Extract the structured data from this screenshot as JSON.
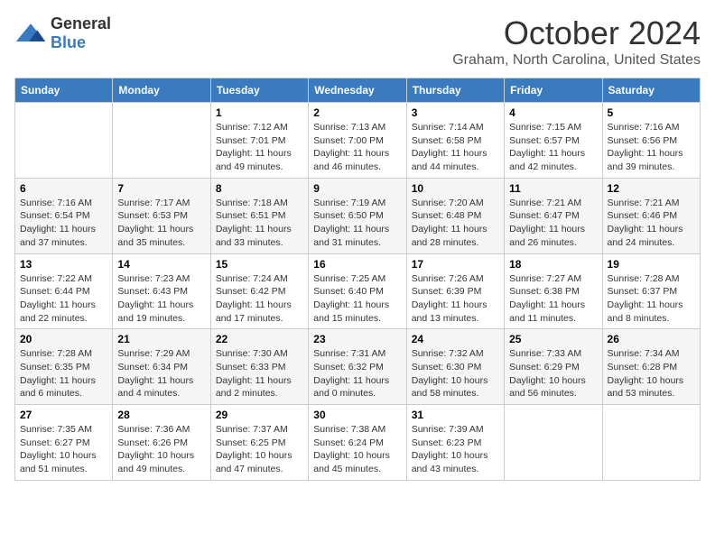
{
  "logo": {
    "general": "General",
    "blue": "Blue"
  },
  "header": {
    "month": "October 2024",
    "location": "Graham, North Carolina, United States"
  },
  "days_of_week": [
    "Sunday",
    "Monday",
    "Tuesday",
    "Wednesday",
    "Thursday",
    "Friday",
    "Saturday"
  ],
  "weeks": [
    [
      {
        "day": "",
        "info": ""
      },
      {
        "day": "",
        "info": ""
      },
      {
        "day": "1",
        "info": "Sunrise: 7:12 AM\nSunset: 7:01 PM\nDaylight: 11 hours and 49 minutes."
      },
      {
        "day": "2",
        "info": "Sunrise: 7:13 AM\nSunset: 7:00 PM\nDaylight: 11 hours and 46 minutes."
      },
      {
        "day": "3",
        "info": "Sunrise: 7:14 AM\nSunset: 6:58 PM\nDaylight: 11 hours and 44 minutes."
      },
      {
        "day": "4",
        "info": "Sunrise: 7:15 AM\nSunset: 6:57 PM\nDaylight: 11 hours and 42 minutes."
      },
      {
        "day": "5",
        "info": "Sunrise: 7:16 AM\nSunset: 6:56 PM\nDaylight: 11 hours and 39 minutes."
      }
    ],
    [
      {
        "day": "6",
        "info": "Sunrise: 7:16 AM\nSunset: 6:54 PM\nDaylight: 11 hours and 37 minutes."
      },
      {
        "day": "7",
        "info": "Sunrise: 7:17 AM\nSunset: 6:53 PM\nDaylight: 11 hours and 35 minutes."
      },
      {
        "day": "8",
        "info": "Sunrise: 7:18 AM\nSunset: 6:51 PM\nDaylight: 11 hours and 33 minutes."
      },
      {
        "day": "9",
        "info": "Sunrise: 7:19 AM\nSunset: 6:50 PM\nDaylight: 11 hours and 31 minutes."
      },
      {
        "day": "10",
        "info": "Sunrise: 7:20 AM\nSunset: 6:48 PM\nDaylight: 11 hours and 28 minutes."
      },
      {
        "day": "11",
        "info": "Sunrise: 7:21 AM\nSunset: 6:47 PM\nDaylight: 11 hours and 26 minutes."
      },
      {
        "day": "12",
        "info": "Sunrise: 7:21 AM\nSunset: 6:46 PM\nDaylight: 11 hours and 24 minutes."
      }
    ],
    [
      {
        "day": "13",
        "info": "Sunrise: 7:22 AM\nSunset: 6:44 PM\nDaylight: 11 hours and 22 minutes."
      },
      {
        "day": "14",
        "info": "Sunrise: 7:23 AM\nSunset: 6:43 PM\nDaylight: 11 hours and 19 minutes."
      },
      {
        "day": "15",
        "info": "Sunrise: 7:24 AM\nSunset: 6:42 PM\nDaylight: 11 hours and 17 minutes."
      },
      {
        "day": "16",
        "info": "Sunrise: 7:25 AM\nSunset: 6:40 PM\nDaylight: 11 hours and 15 minutes."
      },
      {
        "day": "17",
        "info": "Sunrise: 7:26 AM\nSunset: 6:39 PM\nDaylight: 11 hours and 13 minutes."
      },
      {
        "day": "18",
        "info": "Sunrise: 7:27 AM\nSunset: 6:38 PM\nDaylight: 11 hours and 11 minutes."
      },
      {
        "day": "19",
        "info": "Sunrise: 7:28 AM\nSunset: 6:37 PM\nDaylight: 11 hours and 8 minutes."
      }
    ],
    [
      {
        "day": "20",
        "info": "Sunrise: 7:28 AM\nSunset: 6:35 PM\nDaylight: 11 hours and 6 minutes."
      },
      {
        "day": "21",
        "info": "Sunrise: 7:29 AM\nSunset: 6:34 PM\nDaylight: 11 hours and 4 minutes."
      },
      {
        "day": "22",
        "info": "Sunrise: 7:30 AM\nSunset: 6:33 PM\nDaylight: 11 hours and 2 minutes."
      },
      {
        "day": "23",
        "info": "Sunrise: 7:31 AM\nSunset: 6:32 PM\nDaylight: 11 hours and 0 minutes."
      },
      {
        "day": "24",
        "info": "Sunrise: 7:32 AM\nSunset: 6:30 PM\nDaylight: 10 hours and 58 minutes."
      },
      {
        "day": "25",
        "info": "Sunrise: 7:33 AM\nSunset: 6:29 PM\nDaylight: 10 hours and 56 minutes."
      },
      {
        "day": "26",
        "info": "Sunrise: 7:34 AM\nSunset: 6:28 PM\nDaylight: 10 hours and 53 minutes."
      }
    ],
    [
      {
        "day": "27",
        "info": "Sunrise: 7:35 AM\nSunset: 6:27 PM\nDaylight: 10 hours and 51 minutes."
      },
      {
        "day": "28",
        "info": "Sunrise: 7:36 AM\nSunset: 6:26 PM\nDaylight: 10 hours and 49 minutes."
      },
      {
        "day": "29",
        "info": "Sunrise: 7:37 AM\nSunset: 6:25 PM\nDaylight: 10 hours and 47 minutes."
      },
      {
        "day": "30",
        "info": "Sunrise: 7:38 AM\nSunset: 6:24 PM\nDaylight: 10 hours and 45 minutes."
      },
      {
        "day": "31",
        "info": "Sunrise: 7:39 AM\nSunset: 6:23 PM\nDaylight: 10 hours and 43 minutes."
      },
      {
        "day": "",
        "info": ""
      },
      {
        "day": "",
        "info": ""
      }
    ]
  ]
}
